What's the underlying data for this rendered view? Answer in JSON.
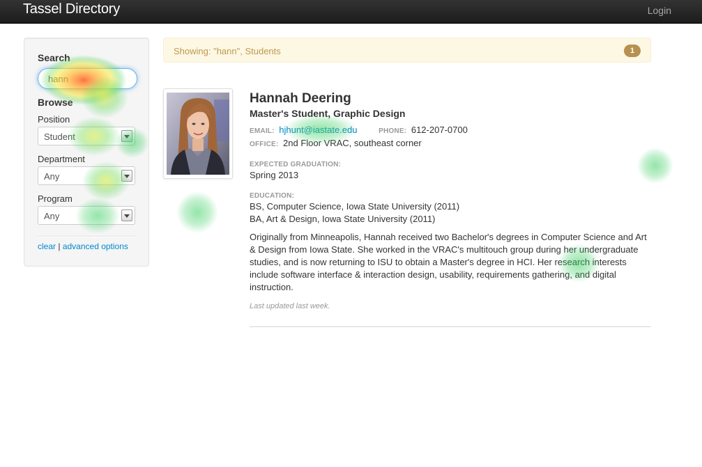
{
  "navbar": {
    "brand": "Tassel Directory",
    "login_label": "Login"
  },
  "sidebar": {
    "search_heading": "Search",
    "search_value": "hann",
    "browse_heading": "Browse",
    "filters": [
      {
        "label": "Position",
        "selected": "Student"
      },
      {
        "label": "Department",
        "selected": "Any"
      },
      {
        "label": "Program",
        "selected": "Any"
      }
    ],
    "links": {
      "clear": "clear",
      "separator": "|",
      "advanced": "advanced options"
    }
  },
  "results": {
    "summary": "Showing: \"hann\", Students",
    "count": "1"
  },
  "profile": {
    "name": "Hannah Deering",
    "title": "Master's Student, Graphic Design",
    "email_label": "EMAIL:",
    "email": "hjhunt@iastate.edu",
    "phone_label": "PHONE:",
    "phone": "612-207-0700",
    "office_label": "OFFICE:",
    "office": "2nd Floor VRAC, southeast corner",
    "graduation_label": "EXPECTED GRADUATION:",
    "graduation": "Spring 2013",
    "education_label": "EDUCATION:",
    "education": [
      "BS, Computer Science, Iowa State University (2011)",
      "BA, Art & Design, Iowa State University (2011)"
    ],
    "bio": "Originally from Minneapolis, Hannah received two Bachelor's degrees in Computer Science and Art & Design from Iowa State. She worked in the VRAC's multitouch group during her undergraduate studies, and is now returning to ISU to obtain a Master's degree in HCI. Her research interests include software interface & interaction design, usability, requirements gathering, and digital instruction.",
    "updated": "Last updated last week."
  },
  "colors": {
    "navbar": "#222222",
    "link": "#0088cc",
    "alert_bg": "#fcf8e3",
    "alert_text": "#c09853",
    "badge": "#b8904f",
    "heat_hot": "#ff6a2b",
    "heat_warm": "#ffe23a",
    "heat_cool": "#3ecf64"
  }
}
